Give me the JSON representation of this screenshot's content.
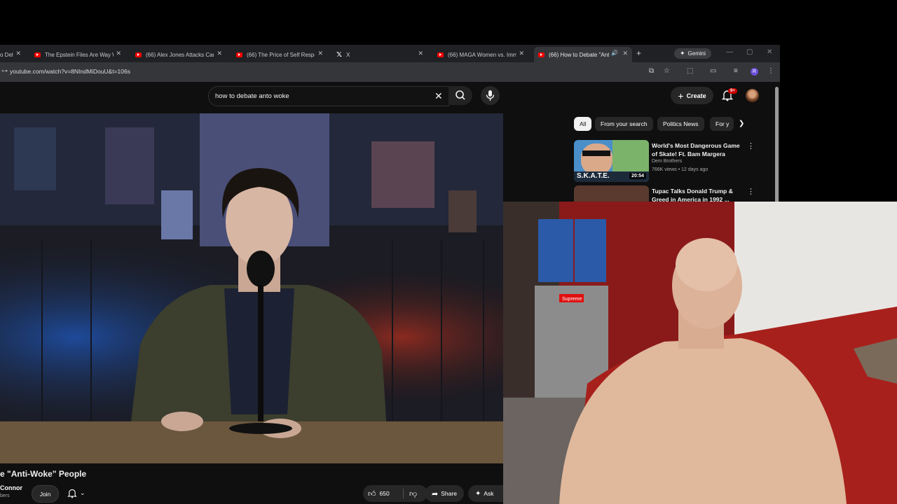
{
  "browser": {
    "tabs": [
      {
        "title": "o Del"
      },
      {
        "title": "The Epstein Files Are Way W"
      },
      {
        "title": "(66) Alex Jones Attacks Cand"
      },
      {
        "title": "(66) The Price of Self Respec"
      },
      {
        "title": "X"
      },
      {
        "title": "(66) MAGA Women vs. Immi"
      },
      {
        "title": "(66) How to Debate \"Anti"
      }
    ],
    "new_tab": "+",
    "gemini_label": "Gemini",
    "url": "youtube.com/watch?v=8NIndMiDouU&t=106s",
    "profile_initial": "R"
  },
  "youtube": {
    "search_query": "how to debate anto woke",
    "create_label": "Create",
    "notifications_badge": "9+",
    "video_title": "e \"Anti-Woke\" People",
    "channel_name": "Connor",
    "channel_subs": "bers",
    "join_label": "Join",
    "like_count": "650",
    "share_label": "Share",
    "ask_label": "Ask",
    "chips": [
      "All",
      "From your search",
      "Politics News",
      "For y"
    ],
    "recommendations": [
      {
        "title": "World's Most Dangerous Game of Skate! Ft. Bam Margera",
        "channel": "Dem Brothers",
        "meta": "766K views • 12 days ago",
        "duration": "20:54",
        "thumb_text": "S.K.A.T.E."
      },
      {
        "title": "Tupac Talks Donald Trump & Greed in America in 1992 ...",
        "channel": "",
        "meta": "",
        "duration": ""
      }
    ]
  },
  "webcam": {
    "sign_text": "Supreme"
  }
}
